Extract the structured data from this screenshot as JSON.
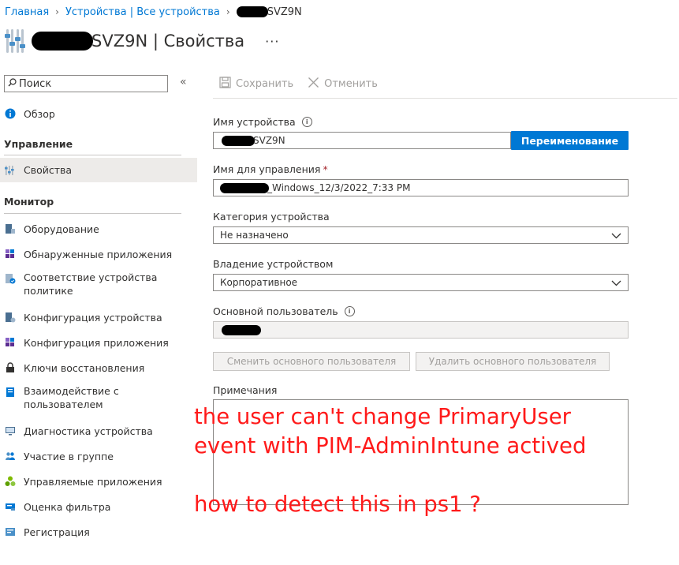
{
  "breadcrumb": {
    "home": "Главная",
    "devices": "Устройства | Все устройства",
    "current_suffix": "SVZ9N"
  },
  "page": {
    "title_suffix": "SVZ9N | Свойства",
    "more": "···"
  },
  "sidebar": {
    "search_placeholder": "Поиск",
    "collapse": "«",
    "overview": "Обзор",
    "section_manage": "Управление",
    "properties": "Свойства",
    "section_monitor": "Монитор",
    "items": [
      {
        "label": "Оборудование",
        "icon": "hardware-icon"
      },
      {
        "label": "Обнаруженные приложения",
        "icon": "apps-grid-icon"
      },
      {
        "label": "Соответствие устройства\nполитике",
        "icon": "compliance-icon"
      },
      {
        "label": "Конфигурация устройства",
        "icon": "device-config-icon"
      },
      {
        "label": "Конфигурация приложения",
        "icon": "app-config-icon"
      },
      {
        "label": "Ключи восстановления",
        "icon": "lock-icon"
      },
      {
        "label": "Взаимодействие с\nпользователем",
        "icon": "book-icon"
      },
      {
        "label": "Диагностика устройства",
        "icon": "monitor-icon"
      },
      {
        "label": "Участие в группе",
        "icon": "group-icon"
      },
      {
        "label": "Управляемые приложения",
        "icon": "managed-apps-icon"
      },
      {
        "label": "Оценка фильтра",
        "icon": "filter-eval-icon"
      },
      {
        "label": "Регистрация",
        "icon": "enrollment-icon"
      }
    ]
  },
  "toolbar": {
    "save": "Сохранить",
    "discard": "Отменить"
  },
  "form": {
    "device_name_label": "Имя устройства",
    "device_name_value_suffix": "SVZ9N",
    "rename_button": "Переименование",
    "management_name_label": "Имя для управления",
    "required_mark": "*",
    "management_name_value_suffix": "_Windows_12/3/2022_7:33 PM",
    "category_label": "Категория устройства",
    "category_value": "Не назначено",
    "ownership_label": "Владение устройством",
    "ownership_value": "Корпоративное",
    "primary_user_label": "Основной пользователь",
    "change_primary_user": "Сменить основного пользователя",
    "remove_primary_user": "Удалить основного пользователя",
    "notes_label": "Примечания"
  },
  "annotation": {
    "text": "the user can't change PrimaryUser\nevent with PIM-AdminIntune actived\n\nhow to detect this in ps1 ?",
    "color": "#ff1a1a"
  },
  "colors": {
    "accent": "#0078d4",
    "nav_active": "#edebe9",
    "disabled_bg": "#f3f2f1"
  }
}
